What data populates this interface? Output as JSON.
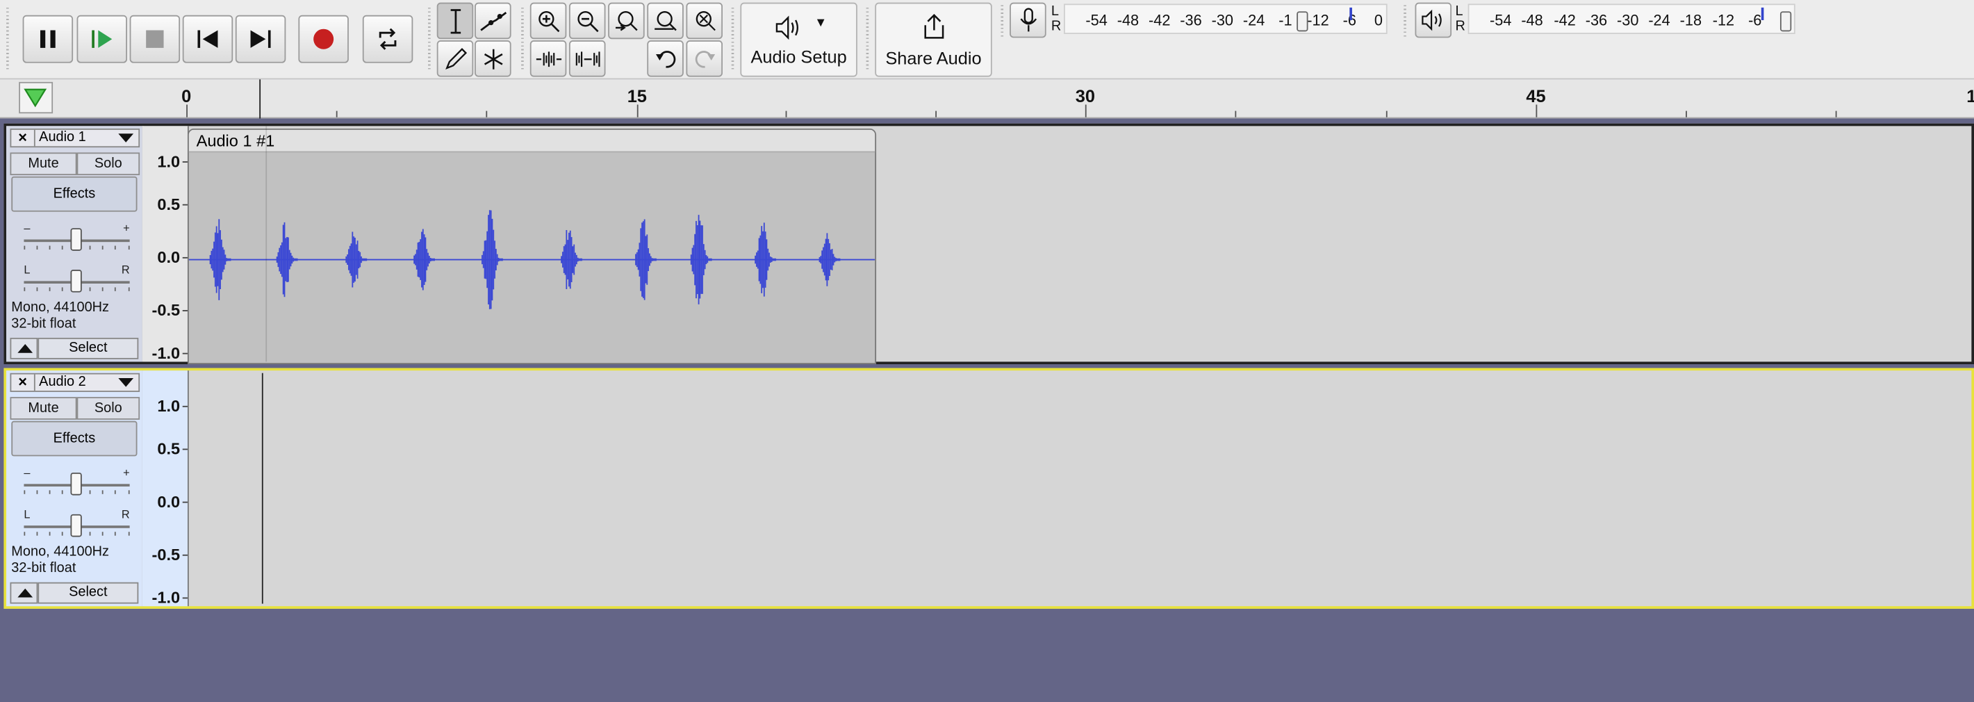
{
  "toolbar": {
    "transport": [
      "pause-button",
      "play-button",
      "stop-button",
      "skip-start-button",
      "skip-end-button",
      "record-button",
      "loop-button"
    ],
    "audio_setup_label": "Audio Setup",
    "share_audio_label": "Share Audio"
  },
  "record_meter": {
    "l": "L",
    "r": "R",
    "ticks": [
      "-54",
      "-48",
      "-42",
      "-36",
      "-30",
      "-24",
      "-1",
      "-12",
      "-6",
      "0"
    ],
    "peak": -6
  },
  "play_meter": {
    "l": "L",
    "r": "R",
    "ticks": [
      "-54",
      "-48",
      "-42",
      "-36",
      "-30",
      "-24",
      "-18",
      "-12",
      "-6",
      "0"
    ],
    "peak": -6
  },
  "ruler": {
    "labels": [
      "0",
      "15",
      "30",
      "45",
      "1"
    ]
  },
  "colors": {
    "waveform": "#3b48d4",
    "selected_border": "#e8e23c",
    "background": "#646587"
  },
  "tracks": [
    {
      "name": "Audio 1",
      "close": "×",
      "mute": "Mute",
      "solo": "Solo",
      "effects": "Effects",
      "gain_minus": "–",
      "gain_plus": "+",
      "pan_left": "L",
      "pan_right": "R",
      "format_line1": "Mono, 44100Hz",
      "format_line2": "32-bit float",
      "select": "Select",
      "scale": [
        "1.0",
        "0.5",
        "0.0",
        "-0.5",
        "-1.0"
      ],
      "clip_title": "Audio 1 #1"
    },
    {
      "name": "Audio 2",
      "close": "×",
      "mute": "Mute",
      "solo": "Solo",
      "effects": "Effects",
      "gain_minus": "–",
      "gain_plus": "+",
      "pan_left": "L",
      "pan_right": "R",
      "format_line1": "Mono, 44100Hz",
      "format_line2": "32-bit float",
      "select": "Select",
      "scale": [
        "1.0",
        "0.5",
        "0.0",
        "-0.5",
        "-1.0"
      ]
    }
  ]
}
